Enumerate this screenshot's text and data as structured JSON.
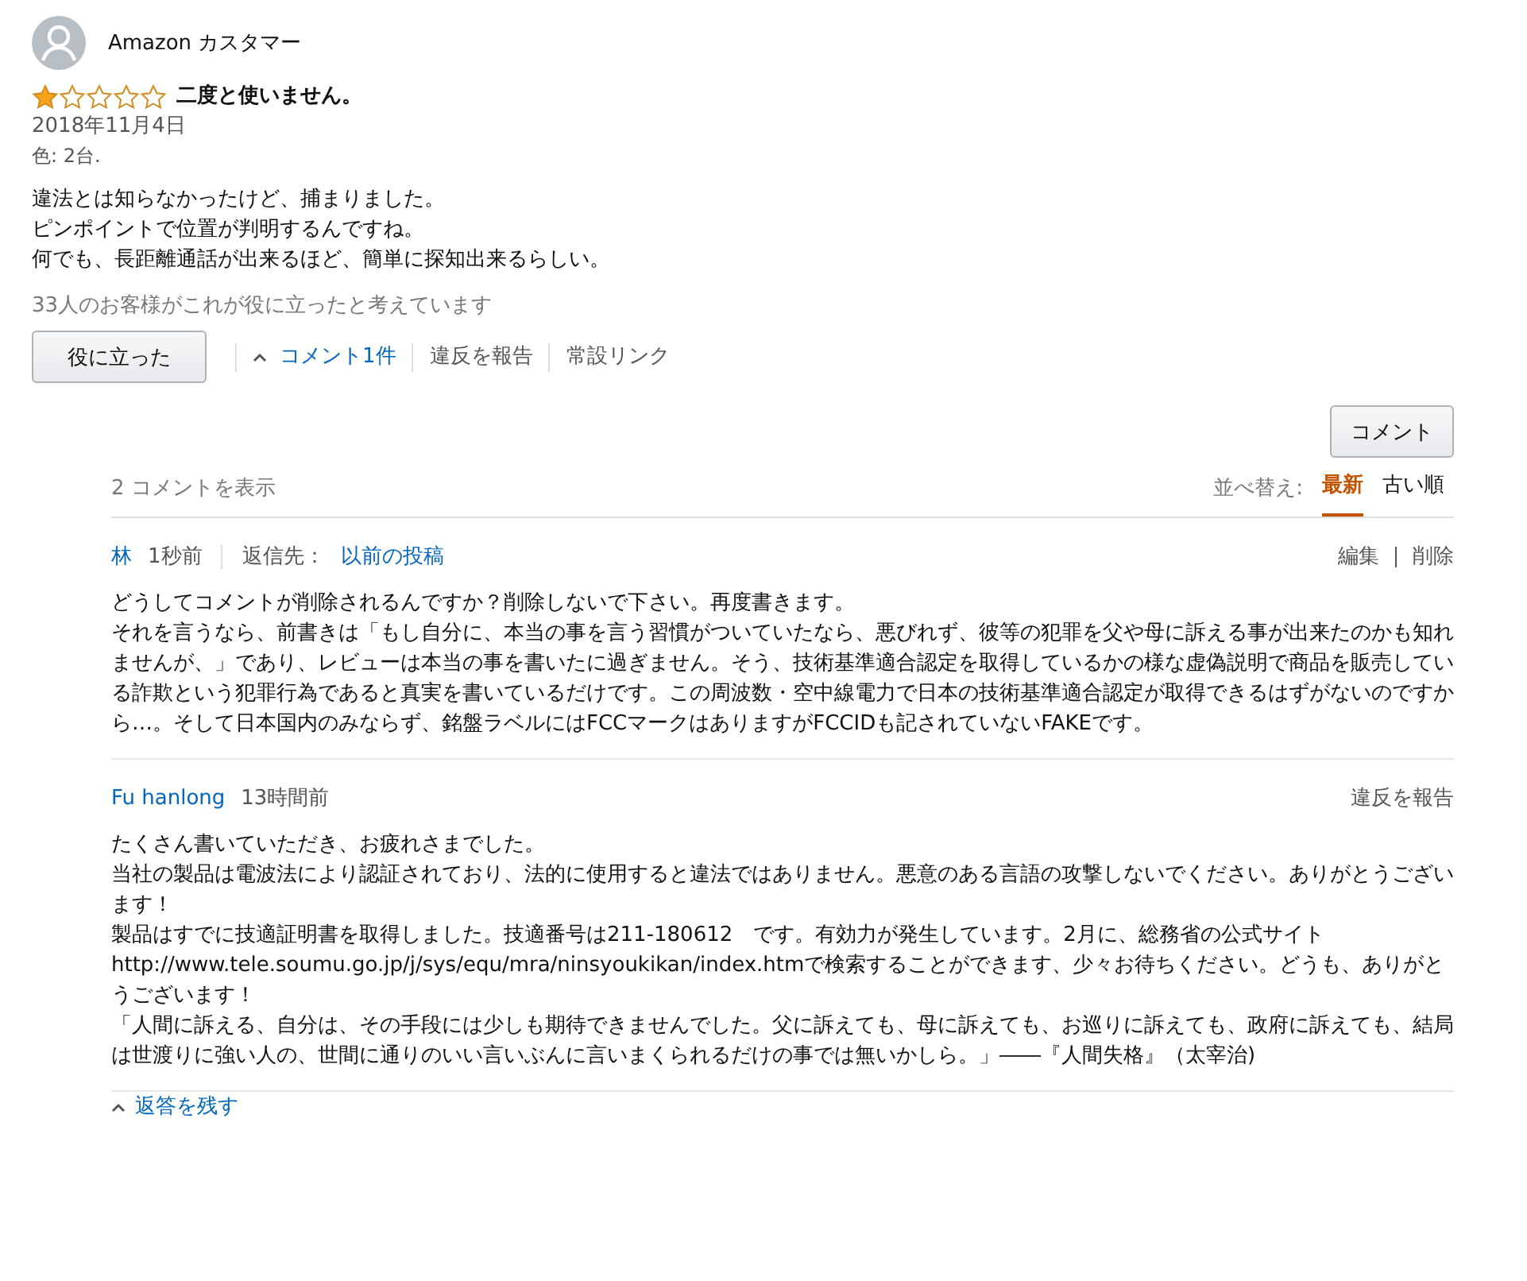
{
  "review": {
    "author": "Amazon カスタマー",
    "stars": 1,
    "title": "二度と使いません。",
    "date": "2018年11月4日",
    "variant": "色: 2台.",
    "body": [
      "違法とは知らなかったけど、捕まりました。",
      "ピンポイントで位置が判明するんですね。",
      "何でも、長距離通話が出来るほど、簡単に探知出来るらしい。"
    ],
    "helpful_count": "33人のお客様がこれが役に立ったと考えています",
    "helpful_button": "役に立った",
    "comments_toggle": {
      "label": "コメント1件",
      "expanded": true
    },
    "report": "違反を報告",
    "permalink": "常設リンク"
  },
  "comments": {
    "button": "コメント",
    "count": "2 コメントを表示",
    "sort_label": "並べ替え:",
    "sort_options": [
      {
        "label": "最新",
        "selected": true
      },
      {
        "label": "古い順",
        "selected": false
      }
    ],
    "items": [
      {
        "author": "林",
        "time": "1秒前",
        "reply_label": "返信先：",
        "reply_link": "以前の投稿",
        "actions": [
          "編集",
          "削除"
        ],
        "body": [
          "どうしてコメントが削除されるんですか？削除しないで下さい。再度書きます。",
          "それを言うなら、前書きは「もし自分に、本当の事を言う習慣がついていたなら、悪びれず、彼等の犯罪を父や母に訴える事が出来たのかも知れませんが、」であり、レビューは本当の事を書いたに過ぎません。そう、技術基準適合認定を取得しているかの様な虚偽説明で商品を販売している詐欺という犯罪行為であると真実を書いているだけです。この周波数・空中線電力で日本の技術基準適合認定が取得できるはずがないのですから…。そして日本国内のみならず、銘盤ラベルにはFCCマークはありますがFCCIDも記されていないFAKEです。"
        ]
      },
      {
        "author": "Fu hanlong",
        "time": "13時間前",
        "actions": [
          "違反を報告"
        ],
        "body": [
          "たくさん書いていただき、お疲れさまでした。",
          "当社の製品は電波法により認証されており、法的に使用すると違法ではありません。悪意のある言語の攻撃しないでください。ありがとうございます！",
          "製品はすでに技適証明書を取得しました。技適番号は211-180612　です。有効力が発生しています。2月に、総務省の公式サイトhttp://www.tele.soumu.go.jp/j/sys/equ/mra/ninsyoukikan/index.htmで検索することができます、少々お待ちください。どうも、ありがとうございます！",
          "「人間に訴える、自分は、その手段には少しも期待できませんでした。父に訴えても、母に訴えても、お巡りに訴えても、政府に訴えても、結局は世渡りに強い人の、世間に通りのいい言いぶんに言いまくられるだけの事では無いかしら。」――『人間失格』（太宰治)"
        ]
      }
    ],
    "reply_link": "返答を残す"
  }
}
